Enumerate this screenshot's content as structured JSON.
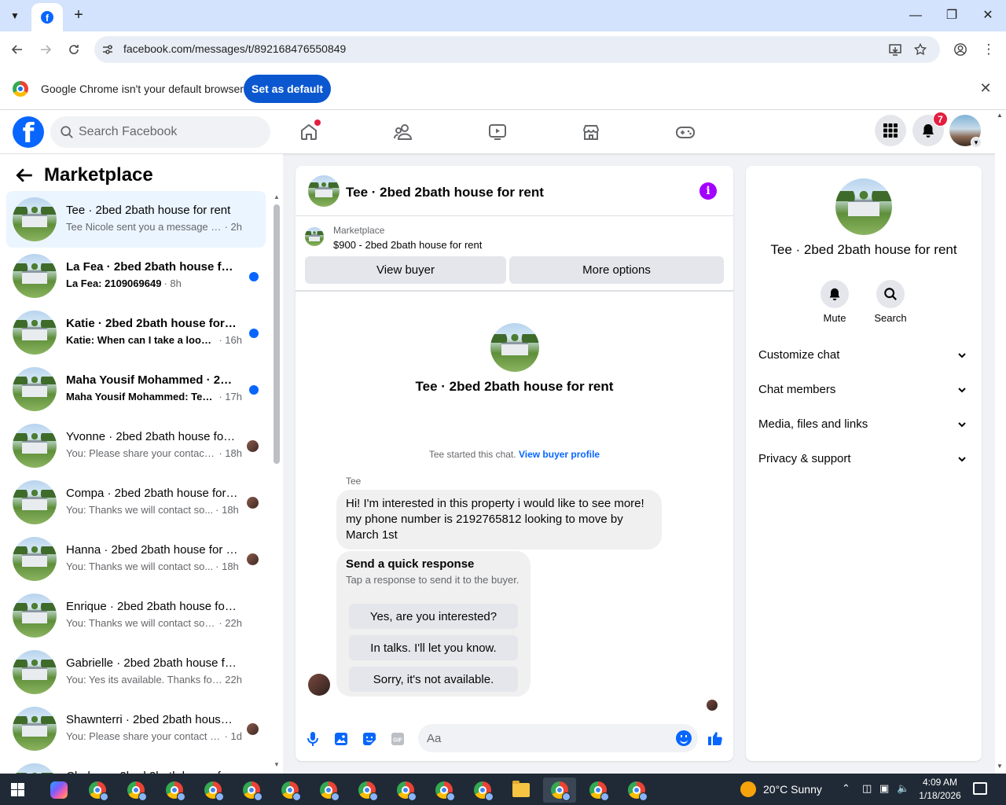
{
  "browser": {
    "url": "facebook.com/messages/t/892168476550849",
    "infobar_text": "Google Chrome isn't your default browser",
    "set_default_label": "Set as default"
  },
  "fb": {
    "search_placeholder": "Search Facebook",
    "notification_count": "7"
  },
  "sidebar": {
    "title": "Marketplace",
    "conversations": [
      {
        "name": "Tee · 2bed 2bath house for rent",
        "preview": "Tee Nicole sent you a message abo...",
        "time": "· 2h",
        "unread": false,
        "active": true,
        "indicator": "none"
      },
      {
        "name": "La Fea · 2bed 2bath house for rent",
        "preview": "La Fea: 2109069649",
        "time": "· 8h",
        "unread": true,
        "active": false,
        "indicator": "dot"
      },
      {
        "name": "Katie · 2bed 2bath house for rent",
        "preview": "Katie: When can I take a look a...",
        "time": "· 16h",
        "unread": true,
        "active": false,
        "indicator": "dot"
      },
      {
        "name": "Maha Yousif Mohammed · 2bed 2bath house for rent",
        "preview": "Maha Yousif Mohammed: Text ...",
        "time": "· 17h",
        "unread": true,
        "active": false,
        "indicator": "dot"
      },
      {
        "name": "Yvonne · 2bed 2bath house for rent",
        "preview": "You: Please share your contact ...",
        "time": "· 18h",
        "unread": false,
        "active": false,
        "indicator": "avatar"
      },
      {
        "name": "Compa · 2bed 2bath house for rent",
        "preview": "You: Thanks we will contact so...",
        "time": "· 18h",
        "unread": false,
        "active": false,
        "indicator": "avatar"
      },
      {
        "name": "Hanna · 2bed 2bath house for rent",
        "preview": "You: Thanks we will contact so...",
        "time": "· 18h",
        "unread": false,
        "active": false,
        "indicator": "avatar"
      },
      {
        "name": "Enrique · 2bed 2bath house for rent",
        "preview": "You: Thanks we will contact soon ...",
        "time": "· 22h",
        "unread": false,
        "active": false,
        "indicator": "none"
      },
      {
        "name": "Gabrielle · 2bed 2bath house for rent",
        "preview": "You: Yes its available. Thanks for re...",
        "time": "22h",
        "unread": false,
        "active": false,
        "indicator": "none"
      },
      {
        "name": "Shawnterri · 2bed 2bath house for rent",
        "preview": "You: Please share your contact n...",
        "time": "· 1d",
        "unread": false,
        "active": false,
        "indicator": "avatar"
      },
      {
        "name": "Chelsea · 2bed 2bath house for rent",
        "preview": "",
        "time": "",
        "unread": false,
        "active": false,
        "indicator": "none"
      }
    ]
  },
  "chat": {
    "title": "Tee · 2bed 2bath house for rent",
    "marketplace_label": "Marketplace",
    "listing": "$900 - 2bed 2bath house for rent",
    "view_buyer_label": "View buyer",
    "more_options_label": "More options",
    "started_text": "Tee started this chat.",
    "view_profile_label": "View buyer profile",
    "sender_name": "Tee",
    "message": "Hi! I'm interested in this property i would like to see more! my phone number is 2192765812 looking to move by March 1st",
    "quick_title": "Send a quick response",
    "quick_sub": "Tap a response to send it to the buyer.",
    "quick_responses": [
      "Yes, are you interested?",
      "In talks. I'll let you know.",
      "Sorry, it's not available."
    ],
    "input_placeholder": "Aa"
  },
  "details": {
    "title": "Tee · 2bed 2bath house for rent",
    "mute_label": "Mute",
    "search_label": "Search",
    "rows": [
      "Customize chat",
      "Chat members",
      "Media, files and links",
      "Privacy & support"
    ]
  },
  "taskbar": {
    "weather": "20°C  Sunny",
    "time": "4:09 AM",
    "date": "1/18/2026"
  },
  "colors": {
    "fb_blue": "#0866ff",
    "info_purple": "#a200ff",
    "badge_red": "#e41e3f"
  }
}
